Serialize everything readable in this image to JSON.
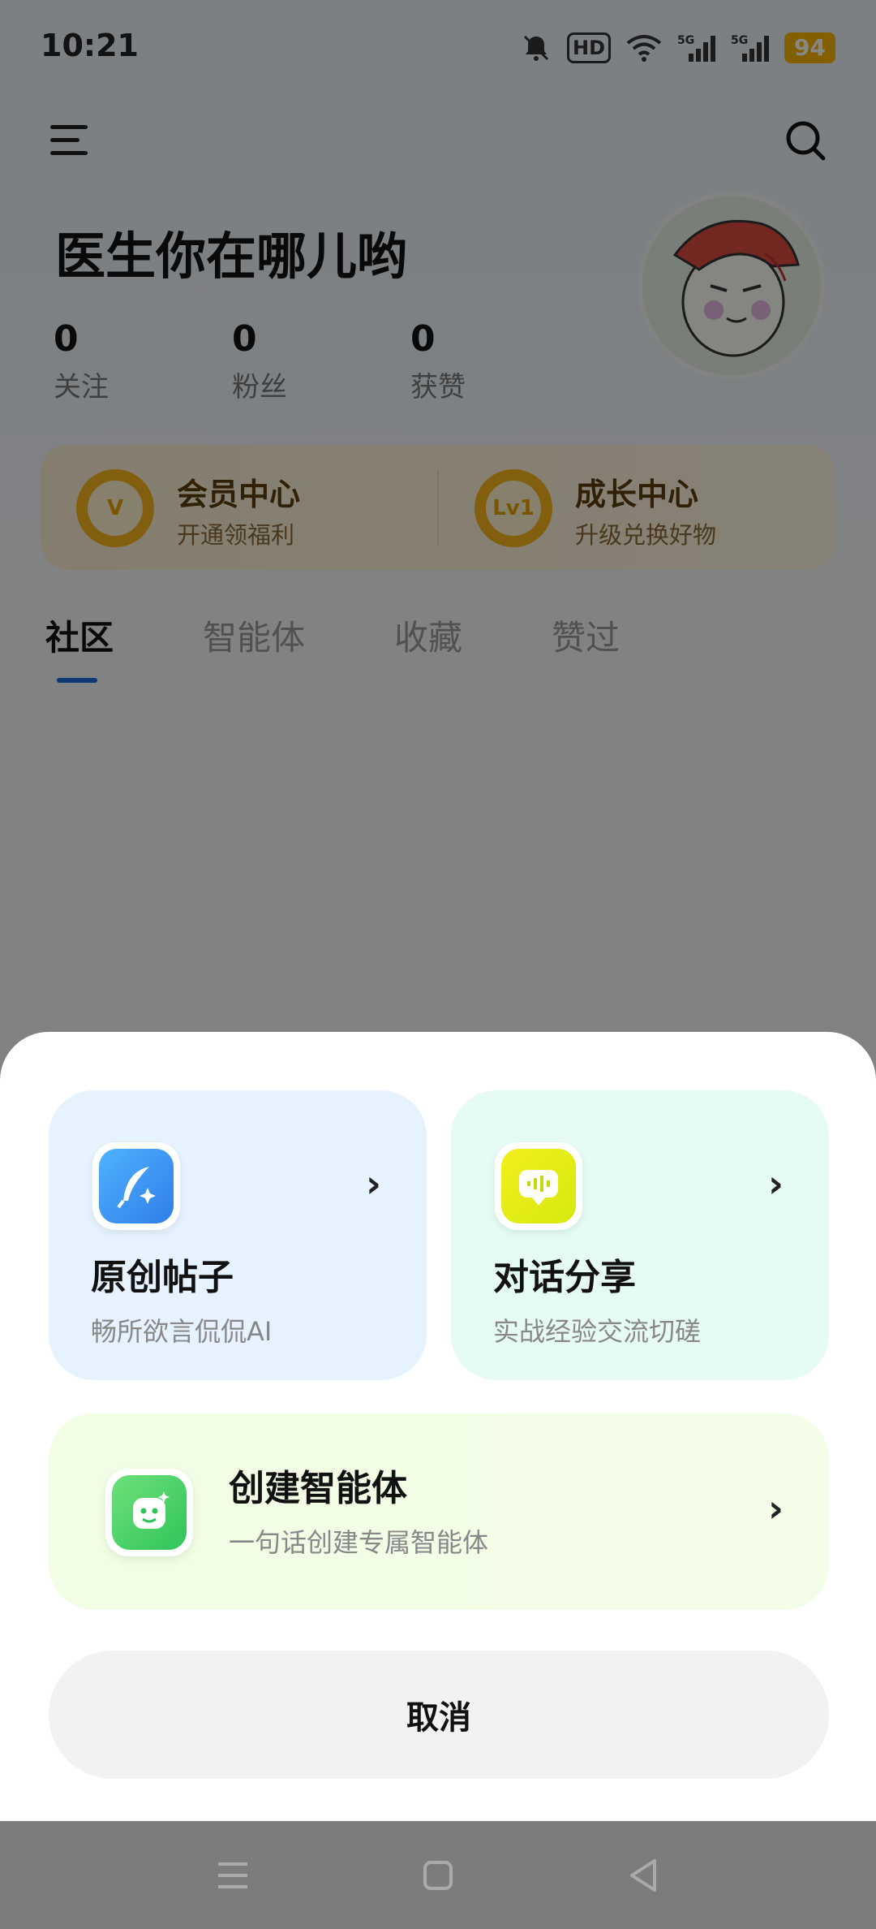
{
  "status_bar": {
    "time": "10:21",
    "hd": "HD",
    "battery": "94"
  },
  "profile": {
    "username": "医生你在哪儿哟",
    "stats": [
      {
        "value": "0",
        "label": "关注"
      },
      {
        "value": "0",
        "label": "粉丝"
      },
      {
        "value": "0",
        "label": "获赞"
      }
    ]
  },
  "member_card": {
    "vip": {
      "title": "会员中心",
      "subtitle": "开通领福利",
      "badge": "V"
    },
    "growth": {
      "title": "成长中心",
      "subtitle": "升级兑换好物",
      "badge": "Lv1"
    }
  },
  "tabs": [
    "社区",
    "智能体",
    "收藏",
    "赞过"
  ],
  "sheet": {
    "post": {
      "title": "原创帖子",
      "subtitle": "畅所欲言侃侃AI"
    },
    "dialog": {
      "title": "对话分享",
      "subtitle": "实战经验交流切磋"
    },
    "agent": {
      "title": "创建智能体",
      "subtitle": "一句话创建专属智能体"
    },
    "cancel": "取消"
  },
  "colors": {
    "accent": "#1d6ad9",
    "gold": "#f3b41b"
  }
}
